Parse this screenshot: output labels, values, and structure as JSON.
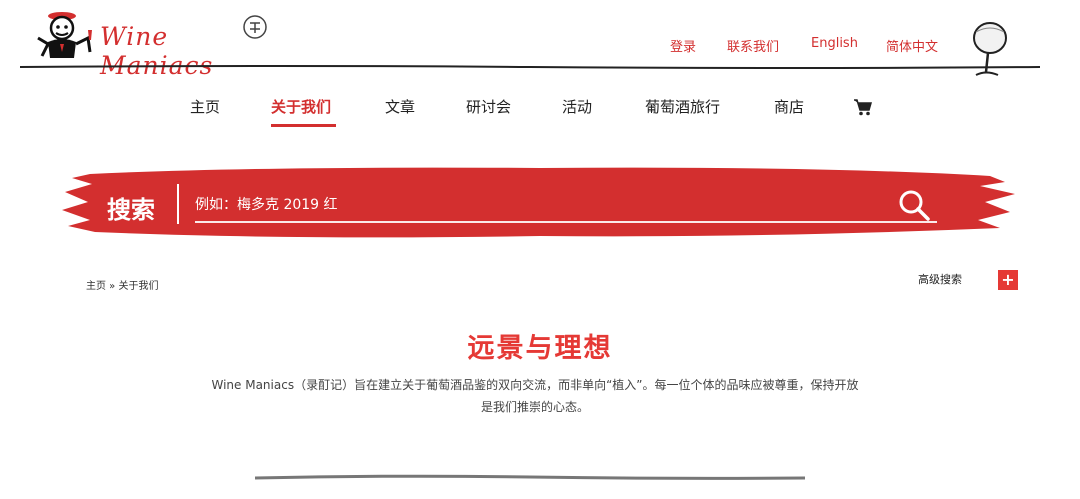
{
  "brand": {
    "logo_text": "Wine Maniacs",
    "accent_color": "#d32f2f"
  },
  "topnav": {
    "login": "登录",
    "contact": "联系我们",
    "english": "English",
    "chinese": "简体中文"
  },
  "mainnav": {
    "home": "主页",
    "about": "关于我们",
    "articles": "文章",
    "seminars": "研讨会",
    "events": "活动",
    "tours": "葡萄酒旅行",
    "shop": "商店",
    "active": "关于我们"
  },
  "search": {
    "label": "搜索",
    "placeholder": "例如：梅多克 2019 红"
  },
  "breadcrumb": {
    "home": "主页",
    "separator": " » ",
    "current": "关于我们"
  },
  "advanced_search": {
    "label": "高级搜索",
    "toggle": "+"
  },
  "content": {
    "title": "远景与理想",
    "description": "Wine Maniacs（录酊记）旨在建立关于葡萄酒品鉴的双向交流，而非单向“植入”。每一位个体的品味应被尊重，保持开放是我们推崇的心态。"
  }
}
